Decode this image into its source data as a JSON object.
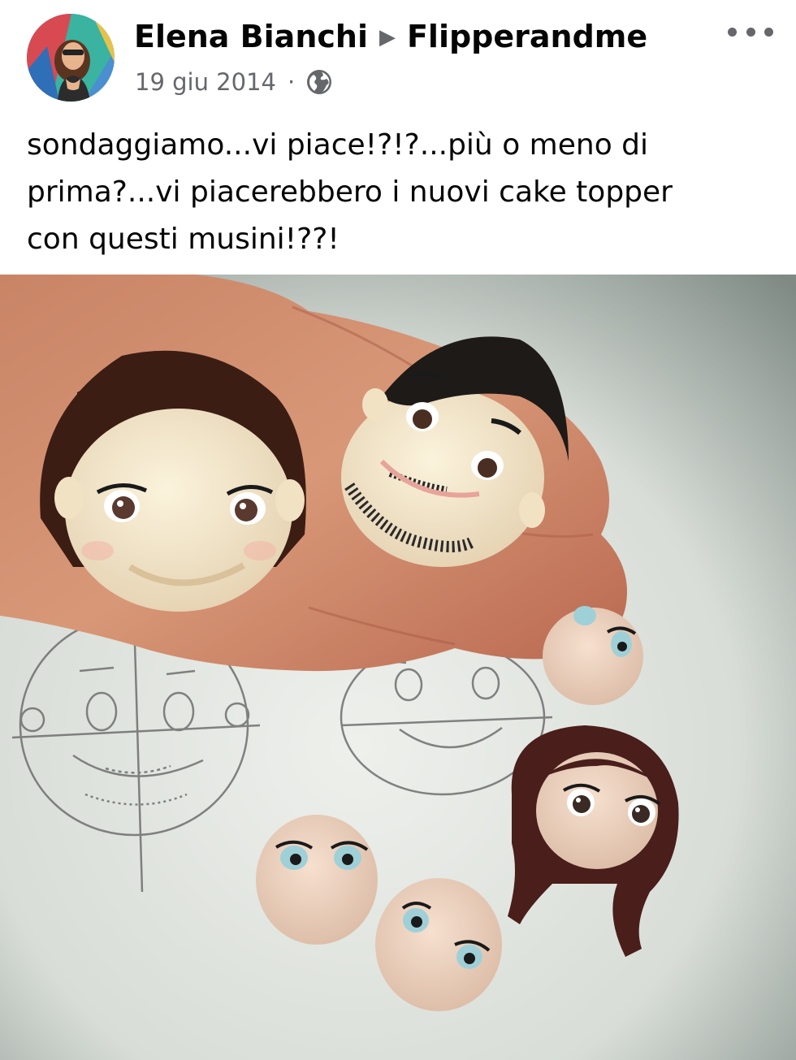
{
  "post": {
    "author": "Elena Bianchi",
    "target": "Flipperandme",
    "date": "19 giu 2014",
    "separator": "·",
    "audience_icon": "globe-icon",
    "more_icon": "more-options-icon",
    "text_lines": [
      "sondaggiamo...vi piace!?!?...più o meno di",
      "prima?...vi piacerebbero i nuovi cake topper",
      "con questi musini!??!"
    ]
  },
  "colors": {
    "text_primary": "#050505",
    "text_secondary": "#65676b"
  }
}
